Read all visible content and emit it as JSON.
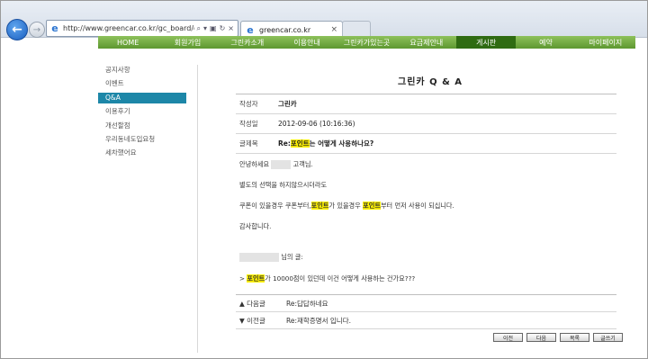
{
  "browser": {
    "url": "http://www.greencar.co.kr/gc_board/green_",
    "tab_title": "greencar.co.kr",
    "close_glyph": "×"
  },
  "menu": {
    "items": [
      "HOME",
      "회원가입",
      "그린카소개",
      "이용안내",
      "그린카가있는곳",
      "요금제안내",
      "게시판",
      "예약",
      "마이페이지"
    ],
    "active": "게시판"
  },
  "sidenav": {
    "items": [
      "공지사항",
      "이벤트",
      "Q&A",
      "이용후기",
      "개선할점",
      "우리동네도입요청",
      "세차했어요"
    ],
    "active": "Q&A"
  },
  "board": {
    "title": "그린카 Q & A",
    "author_label": "작성자",
    "author": "그린카",
    "date_label": "작성일",
    "date": "2012-09-06 (10:16:36)",
    "subject_label": "글제목",
    "subject_prefix": "Re:",
    "subject_highlight": "포인트",
    "subject_rest": "는 어떻게 사용하나요?"
  },
  "body": {
    "greeting_pre": "안녕하세요",
    "greeting_post": "고객님.",
    "line2": "별도의 선택을 하지않으시더라도",
    "line3_a": "쿠폰이 있을경우 쿠폰부터,",
    "line3_hl1": "포인트",
    "line3_b": "가 있을경우",
    "line3_hl2": "포인트",
    "line3_c": "부터 먼저 사용이 되십니다.",
    "thanks": "감사합니다.",
    "quote_post": "님의 글:",
    "quote_prefix": ">",
    "quote_hl": "포인트",
    "quote_rest": "가 10000점이 있던데 이건 어떻게 사용하는 건가요???"
  },
  "nav": {
    "next_label": "▲ 다음글",
    "next_title": "Re:답답하네요",
    "prev_label": "▼ 이전글",
    "prev_title": "Re:재학증명서 입니다."
  },
  "buttons": {
    "prev": "이전",
    "next": "다음",
    "list": "목록",
    "write": "글쓰기"
  }
}
